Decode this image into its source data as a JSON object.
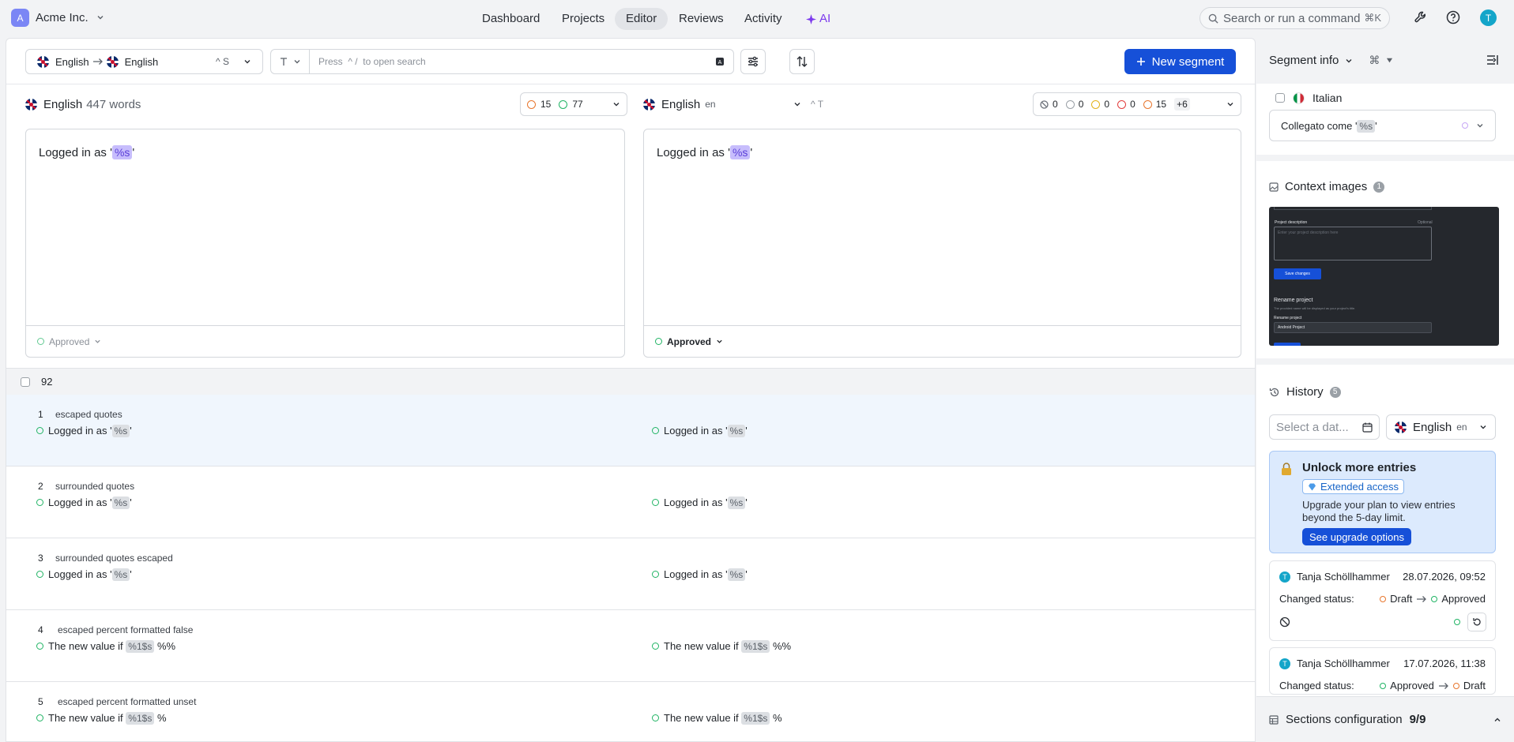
{
  "org": {
    "avatar": "A",
    "name": "Acme Inc."
  },
  "nav": {
    "items": [
      {
        "label": "Dashboard"
      },
      {
        "label": "Projects"
      },
      {
        "label": "Editor"
      },
      {
        "label": "Reviews"
      },
      {
        "label": "Activity"
      },
      {
        "label": "AI"
      }
    ]
  },
  "search": {
    "placeholder": "Search or run a command",
    "shortcut": "⌘K"
  },
  "user": {
    "avatar": "T"
  },
  "toolbar": {
    "source_lang": "English",
    "target_lang": "English",
    "pair_shortcut": "^ S",
    "search_placeholder": "Press  ^ /  to open search",
    "new_segment": "New segment"
  },
  "source": {
    "lang": "English",
    "words": "447 words",
    "stat_orange": "15",
    "stat_green": "77",
    "text_before": "Logged in as '",
    "placeholder": "%s",
    "text_after": "'",
    "status": "Approved"
  },
  "target": {
    "lang": "English",
    "lang_code": "en",
    "shortcut": "^ T",
    "stats": {
      "skip": "0",
      "grey": "0",
      "yellow": "0",
      "red": "0",
      "orange": "15",
      "more": "+6"
    },
    "text_before": "Logged in as '",
    "placeholder": "%s",
    "text_after": "'",
    "status": "Approved"
  },
  "list": {
    "count": "92",
    "rows": [
      {
        "num": "1",
        "key": "escaped quotes",
        "before": "Logged in as '",
        "ph": "%s",
        "after": "'"
      },
      {
        "num": "2",
        "key": "surrounded quotes",
        "before": "Logged in as '",
        "ph": "%s",
        "after": "'"
      },
      {
        "num": "3",
        "key": "surrounded quotes escaped",
        "before": "Logged in as '",
        "ph": "%s",
        "after": "'"
      },
      {
        "num": "4",
        "key": "escaped percent formatted false",
        "before": "The new value if",
        "ph": "%1$s",
        "after": "%%"
      },
      {
        "num": "5",
        "key": "escaped percent formatted unset",
        "before": "The new value if",
        "ph": "%1$s",
        "after": "%"
      }
    ]
  },
  "sidebar": {
    "title": "Segment info",
    "title_shortcut": "⌘",
    "italian": {
      "label": "Italian",
      "before": "Collegato come '",
      "ph": "%s",
      "after": "'"
    },
    "context": {
      "title": "Context images",
      "count": "1",
      "img": {
        "desc_label": "Project description",
        "optional": "Optional",
        "desc_placeholder": "Enter your project description here",
        "save": "Save changes",
        "rename": "Rename project",
        "rename_sub": "The provided name will be displayed as your project's title.",
        "rename_label": "Rename project",
        "rename_value": "Android Project"
      }
    },
    "history": {
      "title": "History",
      "count": "5",
      "date_placeholder": "Select a dat...",
      "lang": "English",
      "lang_code": "en",
      "unlock": {
        "title": "Unlock more entries",
        "badge": "Extended access",
        "text": "Upgrade your plan to view entries beyond the 5-day limit.",
        "button": "See upgrade options"
      },
      "entries": [
        {
          "avatar": "T",
          "user": "Tanja Schöllhammer",
          "date": "28.07.2026, 09:52",
          "label": "Changed status:",
          "from": "Draft",
          "to": "Approved"
        },
        {
          "avatar": "T",
          "user": "Tanja Schöllhammer",
          "date": "17.07.2026, 11:38",
          "label": "Changed status:",
          "from": "Approved",
          "to": "Draft"
        }
      ]
    },
    "sections": {
      "title": "Sections configuration",
      "count": "9/9"
    }
  }
}
